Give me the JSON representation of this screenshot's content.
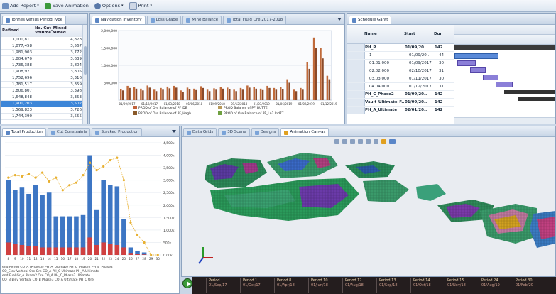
{
  "toolbar": {
    "items": [
      {
        "label": "Add Report",
        "icon": "report-icon"
      },
      {
        "label": "Save Animation",
        "icon": "animation-icon"
      },
      {
        "label": "Options",
        "icon": "gear-icon"
      },
      {
        "label": "Print",
        "icon": "print-icon"
      }
    ]
  },
  "grid_panel": {
    "tab_label": "Tonnes versus Period Type",
    "col1": "Refined",
    "col2": "No. Cut_Mined",
    "col2b": "Volume Mined",
    "rows": [
      [
        "3,000,811",
        "4,878"
      ],
      [
        "1,877,458",
        "3,567"
      ],
      [
        "1,981,903",
        "3,772"
      ],
      [
        "1,804,670",
        "3,639"
      ],
      [
        "1,736,388",
        "3,804"
      ],
      [
        "1,908,971",
        "3,805"
      ],
      [
        "1,752,696",
        "3,316"
      ],
      [
        "1,781,517",
        "3,359"
      ],
      [
        "1,806,807",
        "3,398"
      ],
      [
        "1,648,848",
        "3,353"
      ],
      [
        "1,900,203",
        "3,502"
      ],
      [
        "1,569,823",
        "3,726"
      ],
      [
        "1,744,390",
        "3,555"
      ]
    ],
    "selected_row": 10
  },
  "bar_panel": {
    "tabs": [
      "Navigation Inventory",
      "Loss Grade",
      "Mine Balance",
      "Total Fluid Ore 2017-2018"
    ],
    "legend": [
      {
        "label": "PROD of Ore Balance of PF_DB",
        "color": "#c0623a"
      },
      {
        "label": "PROD Balance of PF_BUTTE",
        "color": "#b89a5a"
      },
      {
        "label": "PROD of Ore Balance of PF_Hagh",
        "color": "#8a5a2a"
      },
      {
        "label": "PROD of Ore Balance of PF_Ln2 Ind77",
        "color": "#6fa040"
      }
    ]
  },
  "gantt_panel": {
    "tab_label": "Schedule Gantt",
    "headers": [
      "Name",
      "Start",
      "Dur"
    ],
    "rows": [
      [
        "PH_R",
        "01/09/20..",
        "142"
      ],
      [
        "1",
        "01/09/20..",
        "44"
      ],
      [
        "01.01.000",
        "01/09/2017",
        "30"
      ],
      [
        "02.02.000",
        "02/10/2017",
        "31"
      ],
      [
        "03.03.000",
        "01/11/2017",
        "30"
      ],
      [
        "04.04.000",
        "01/12/2017",
        "31"
      ],
      [
        "PH_C_Phase2",
        "01/09/20..",
        "142"
      ],
      [
        "Vault_Ultimate_F..",
        "01/09/20..",
        "142"
      ],
      [
        "PH_A_Ultimate",
        "02/01/20..",
        "142"
      ]
    ]
  },
  "lower_left_panel": {
    "tabs": [
      "Total Production",
      "Cut Constraints",
      "Stacked Production"
    ],
    "right_axis": [
      "4,500k",
      "4,000k",
      "3,500k",
      "3,000k",
      "2,500k",
      "2,000k",
      "1,500k",
      "1,000k",
      "500k",
      "0.00k"
    ],
    "x_ticks": [
      "8",
      "9",
      "10",
      "11",
      "12",
      "13",
      "14",
      "15",
      "16",
      "17",
      "18",
      "19",
      "20",
      "21",
      "22",
      "23",
      "24",
      "25",
      "26",
      "27",
      "28",
      "29",
      "30"
    ],
    "legend_lines": [
      "end Period CO_A (Phase3) PH_A_Ultimate PH_C_Phase2 PH_B_Phase2",
      "CO_Elev Vertical Ore Ore CO_A PH_C Ultimate PH_A Ultimate",
      "end Fuel Gr_A Phase2 Ore CO_A PH_C_Phase2 Ultimate",
      "CO_B Elev Vertical CO_B Phase3 CO_A Ultimate PH_C Ore"
    ]
  },
  "view3d_panel": {
    "tabs": [
      "Data Grids",
      "3D Scene",
      "Designs",
      "Animation Canvas"
    ]
  },
  "timeline": {
    "periods": [
      {
        "label": "Period",
        "date": "01/Sep/17"
      },
      {
        "label": "Period 1",
        "date": "01/Oct/17"
      },
      {
        "label": "Period 8",
        "date": "01/Apr/18"
      },
      {
        "label": "Period 10",
        "date": "01/Jun/18"
      },
      {
        "label": "Period 12",
        "date": "01/Aug/18"
      },
      {
        "label": "Period 13",
        "date": "01/Sep/18"
      },
      {
        "label": "Period 14",
        "date": "01/Oct/18"
      },
      {
        "label": "Period 15",
        "date": "01/Nov/18"
      },
      {
        "label": "Period 24",
        "date": "01/Aug/19"
      },
      {
        "label": "Period 30",
        "date": "01/Feb/20"
      }
    ]
  },
  "chart_data": [
    {
      "type": "bar",
      "title": "",
      "ylabel": "",
      "xlabel": "",
      "ylim": [
        0,
        2000000
      ],
      "y_ticks": [
        "2,000,000",
        "1,500,000",
        "1,000,000",
        "500,000"
      ],
      "x_ticks": [
        "01/09/2017",
        "01/12/2017",
        "01/03/2018",
        "01/06/2018",
        "01/09/2018",
        "01/12/2018",
        "01/03/2019",
        "01/06/2019",
        "01/09/2019",
        "01/12/2019"
      ],
      "series": [
        {
          "name": "PROD of Ore Balance of PF_DB",
          "values": [
            320000,
            410000,
            380000,
            330000,
            420000,
            300000,
            350000,
            390000,
            410000,
            280000,
            360000,
            330000,
            400000,
            300000,
            340000,
            380000,
            360000,
            300000,
            350000,
            420000,
            380000,
            330000,
            410000,
            350000,
            370000,
            600000,
            300000,
            350000,
            1100000,
            1800000,
            1500000,
            700000
          ]
        },
        {
          "name": "PROD of Ore Balance of PF_Hagh",
          "values": [
            280000,
            350000,
            330000,
            280000,
            360000,
            260000,
            300000,
            340000,
            360000,
            240000,
            310000,
            290000,
            350000,
            260000,
            300000,
            330000,
            310000,
            260000,
            300000,
            360000,
            330000,
            290000,
            350000,
            300000,
            320000,
            500000,
            260000,
            300000,
            900000,
            1500000,
            1200000,
            600000
          ]
        }
      ]
    },
    {
      "type": "bar",
      "title": "",
      "categories": [
        "8",
        "9",
        "10",
        "11",
        "12",
        "13",
        "14",
        "15",
        "16",
        "17",
        "18",
        "19",
        "20",
        "21",
        "22",
        "23",
        "24",
        "25",
        "26",
        "27",
        "28",
        "29",
        "30"
      ],
      "ylim": [
        0,
        4500000
      ],
      "series": [
        {
          "name": "",
          "color": "#3d76c4",
          "values": [
            3000000,
            2600000,
            2700000,
            2450000,
            2800000,
            2400000,
            2500000,
            1550000,
            1550000,
            1550000,
            1550000,
            1600000,
            4000000,
            1800000,
            3000000,
            2800000,
            2750000,
            1450000,
            300000,
            150000,
            100000,
            0,
            0
          ]
        },
        {
          "name": "",
          "color": "#d04040",
          "values": [
            500000,
            450000,
            400000,
            350000,
            350000,
            300000,
            300000,
            300000,
            300000,
            300000,
            300000,
            300000,
            700000,
            400000,
            500000,
            450000,
            400000,
            300000,
            80000,
            40000,
            20000,
            0,
            0
          ]
        },
        {
          "name": "",
          "type": "line",
          "color": "#e8b030",
          "values": [
            3100000,
            3200000,
            3150000,
            3250000,
            3100000,
            3300000,
            2950000,
            3100000,
            2600000,
            2800000,
            2900000,
            3200000,
            3700000,
            3400000,
            3550000,
            3800000,
            3900000,
            3000000,
            1300000,
            800000,
            500000,
            0,
            0
          ]
        }
      ]
    }
  ]
}
